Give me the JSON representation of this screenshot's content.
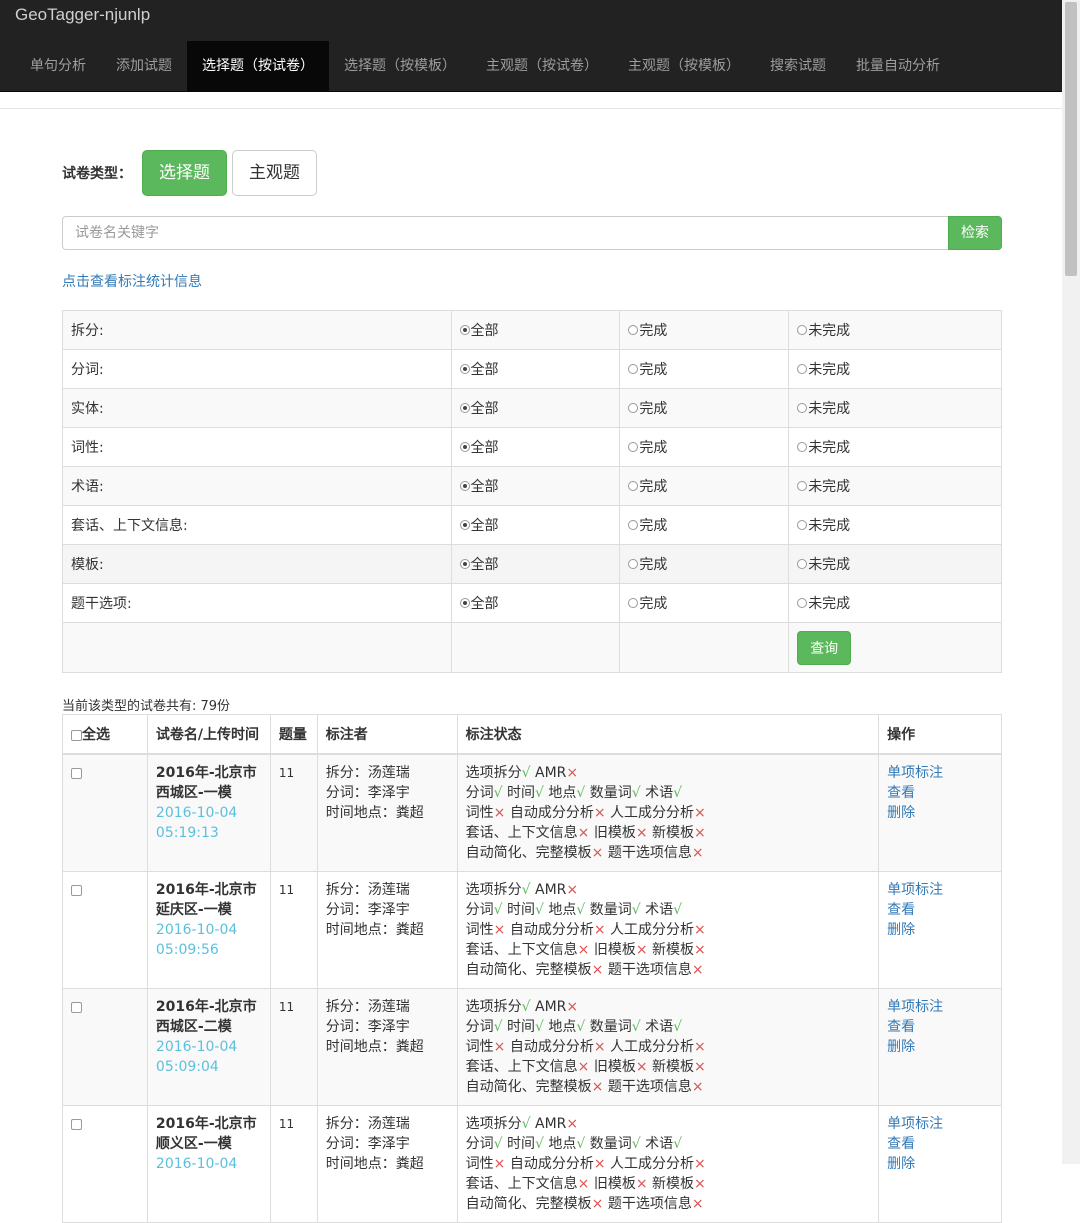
{
  "brand": "GeoTagger-njunlp",
  "nav": [
    {
      "label": "单句分析"
    },
    {
      "label": "添加试题"
    },
    {
      "label": "选择题（按试卷）"
    },
    {
      "label": "选择题（按模板）"
    },
    {
      "label": "主观题（按试卷）"
    },
    {
      "label": "主观题（按模板）"
    },
    {
      "label": "搜索试题"
    },
    {
      "label": "批量自动分析"
    }
  ],
  "nav_active": 2,
  "type_label": "试卷类型：",
  "type_buttons": [
    "选择题",
    "主观题"
  ],
  "search": {
    "placeholder": "试卷名关键字",
    "button": "检索"
  },
  "stats_link": "点击查看标注统计信息",
  "filter": {
    "options": [
      "全部",
      "完成",
      "未完成"
    ],
    "rows": [
      "拆分:",
      "分词:",
      "实体:",
      "词性:",
      "术语:",
      "套话、上下文信息:",
      "模板:",
      "题干选项:"
    ],
    "query_button": "查询"
  },
  "count_text": "当前该类型的试卷共有: 79份",
  "table": {
    "headers": [
      "全选",
      "试卷名/上传时间",
      "题量",
      "标注者",
      "标注状态",
      "操作"
    ],
    "rows": [
      {
        "name_line1": "2016年-北京市",
        "name_line2": "西城区-一模",
        "date": "2016-10-04",
        "time": "05:19:13",
        "count": "11",
        "annotators": [
          "拆分：汤莲瑞",
          "分词：李泽宇",
          "时间地点：粪超"
        ]
      },
      {
        "name_line1": "2016年-北京市",
        "name_line2": "延庆区-一模",
        "date": "2016-10-04",
        "time": "05:09:56",
        "count": "11",
        "annotators": [
          "拆分：汤莲瑞",
          "分词：李泽宇",
          "时间地点：粪超"
        ]
      },
      {
        "name_line1": "2016年-北京市",
        "name_line2": "西城区-二模",
        "date": "2016-10-04",
        "time": "05:09:04",
        "count": "11",
        "annotators": [
          "拆分：汤莲瑞",
          "分词：李泽宇",
          "时间地点：粪超"
        ]
      },
      {
        "name_line1": "2016年-北京市",
        "name_line2": "顺义区-一模",
        "date": "2016-10-04",
        "time": "",
        "count": "11",
        "annotators": [
          "拆分：汤莲瑞",
          "分词：李泽宇",
          "时间地点：粪超"
        ]
      }
    ],
    "status": {
      "marks": {
        "ok": "√",
        "bad": "×"
      },
      "lines": [
        [
          {
            "label": "选项拆分",
            "ok": true
          },
          {
            "label": "AMR",
            "ok": false
          }
        ],
        [
          {
            "label": "分词",
            "ok": true
          },
          {
            "label": "时间",
            "ok": true
          },
          {
            "label": "地点",
            "ok": true
          },
          {
            "label": "数量词",
            "ok": true
          },
          {
            "label": "术语",
            "ok": true
          }
        ],
        [
          {
            "label": "词性",
            "ok": false
          },
          {
            "label": "自动成分分析",
            "ok": false
          },
          {
            "label": "人工成分分析",
            "ok": false
          }
        ],
        [
          {
            "label": "套话、上下文信息",
            "ok": false
          },
          {
            "label": "旧模板",
            "ok": false
          },
          {
            "label": "新模板",
            "ok": false
          }
        ],
        [
          {
            "label": "自动简化、完整模板",
            "ok": false
          },
          {
            "label": "题干选项信息",
            "ok": false
          }
        ]
      ]
    },
    "ops": [
      "单项标注",
      "查看",
      "删除"
    ]
  }
}
